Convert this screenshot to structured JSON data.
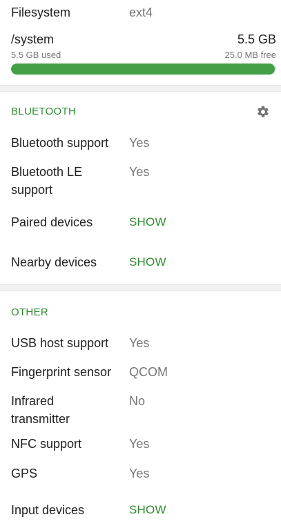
{
  "filesystem": {
    "label": "Filesystem",
    "value": "ext4"
  },
  "storage": {
    "name": "/system",
    "size": "5.5 GB",
    "used": "5.5 GB used",
    "free": "25.0 MB free",
    "fill_fraction": 0.996,
    "bar_color": "#43a047"
  },
  "bluetooth": {
    "title": "BLUETOOTH",
    "settings_icon": "gear-icon",
    "rows": [
      {
        "label": "Bluetooth support",
        "value": "Yes"
      },
      {
        "label": "Bluetooth LE support",
        "value": "Yes"
      },
      {
        "label": "Paired devices",
        "action": "SHOW"
      },
      {
        "label": "Nearby devices",
        "action": "SHOW"
      }
    ]
  },
  "other": {
    "title": "OTHER",
    "rows": [
      {
        "label": "USB host support",
        "value": "Yes"
      },
      {
        "label": "Fingerprint sensor",
        "value": "QCOM"
      },
      {
        "label": "Infrared transmitter",
        "value": "No"
      },
      {
        "label": "NFC support",
        "value": "Yes"
      },
      {
        "label": "GPS",
        "value": "Yes"
      },
      {
        "label": "Input devices",
        "action": "SHOW"
      }
    ]
  },
  "colors": {
    "accent": "#2e8b2e",
    "value_text": "#757575",
    "divider": "#f2f2f2"
  }
}
